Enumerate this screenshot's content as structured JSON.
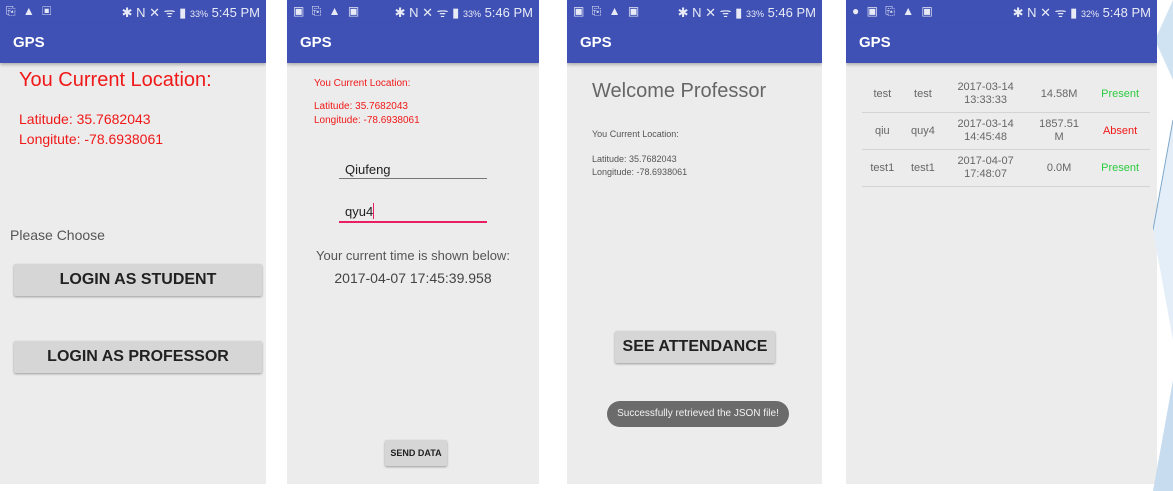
{
  "status_bars": [
    {
      "left": "⎘ ▲ ▣",
      "right_icons": "✱ N ✕ ᯤ ▮",
      "battery": "33%",
      "time": "5:45 PM"
    },
    {
      "left": "▣ ⎘ ▲ ▣",
      "right_icons": "✱ N ✕ ᯤ ▮",
      "battery": "33%",
      "time": "5:46 PM"
    },
    {
      "left": "▣ ⎘ ▲ ▣",
      "right_icons": "✱ N ✕ ᯤ ▮",
      "battery": "33%",
      "time": "5:46 PM"
    },
    {
      "left": "● ▣ ⎘ ▲ ▣",
      "right_icons": "✱ N ✕ ᯤ ▮",
      "battery": "32%",
      "time": "5:48 PM"
    }
  ],
  "app_title": "GPS",
  "screen1": {
    "location_heading": "You Current Location:",
    "latitude": "Latitude:  35.7682043",
    "longitude": "Longitute:  -78.6938061",
    "please_choose": "Please Choose",
    "student_button": "LOGIN AS STUDENT",
    "professor_button": "LOGIN AS PROFESSOR"
  },
  "screen2": {
    "location_heading": "You Current Location:",
    "latitude": "Latitude: 35.7682043",
    "longitude": "Longitude: -78.6938061",
    "username_value": "Qiufeng",
    "password_value": "qyu4",
    "time_label": "Your current time is shown below:",
    "time_value": "2017-04-07 17:45:39.958",
    "send_button": "SEND DATA"
  },
  "screen3": {
    "welcome": "Welcome Professor",
    "location_heading": "You Current Location:",
    "latitude": "Latitude: 35.7682043",
    "longitude": "Longitude: -78.6938061",
    "attendance_button": "SEE ATTENDANCE",
    "toast": "Successfully retrieved the JSON file!"
  },
  "screen4": {
    "rows": [
      {
        "name": "test",
        "password": "test",
        "date": "2017-03-14",
        "time": "13:33:33",
        "distance": "14.58M",
        "distance2": "",
        "status": "Present"
      },
      {
        "name": "qiu",
        "password": "quy4",
        "date": "2017-03-14",
        "time": "14:45:48",
        "distance": "1857.51",
        "distance2": "M",
        "status": "Absent"
      },
      {
        "name": "test1",
        "password": "test1",
        "date": "2017-04-07",
        "time": "17:48:07",
        "distance": "0.0M",
        "distance2": "",
        "status": "Present"
      }
    ]
  },
  "colors": {
    "primary": "#3f51b5",
    "error_red": "#f01818",
    "present_green": "#2ecc40",
    "background": "#ececec"
  }
}
